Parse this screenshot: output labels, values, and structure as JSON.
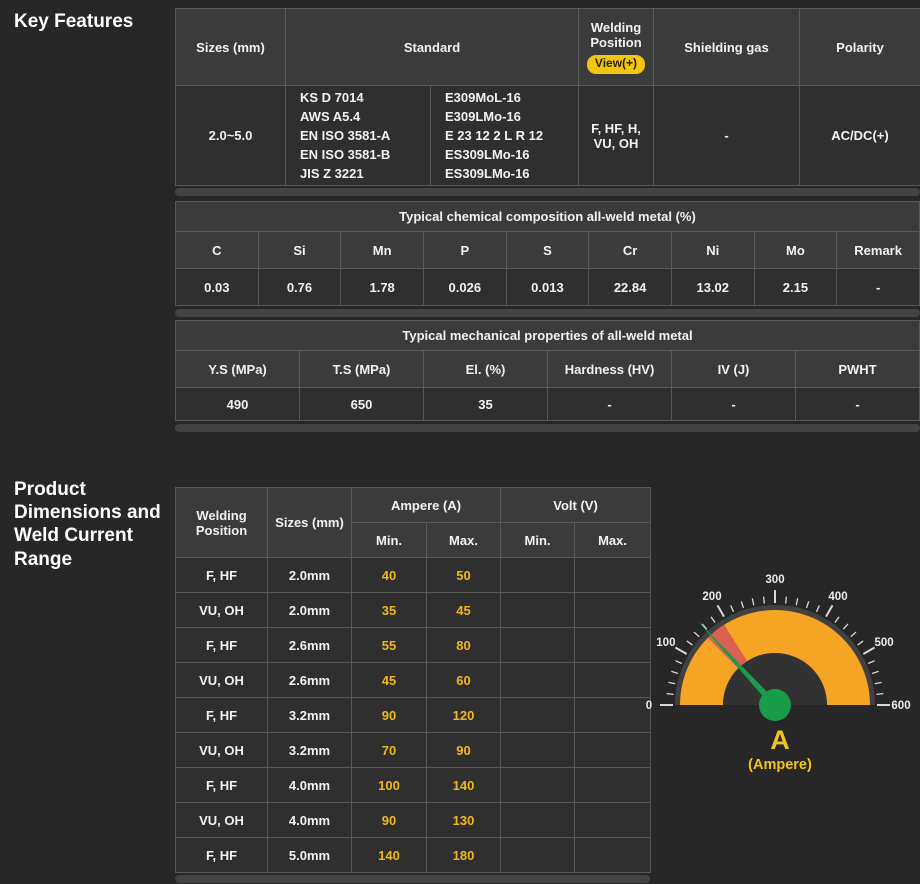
{
  "headings": {
    "key_features": "Key Features",
    "product_dimensions": "Product Dimensions and Weld Current Range"
  },
  "spec_table": {
    "headers": {
      "sizes": "Sizes (mm)",
      "standard": "Standard",
      "welding_position": "Welding Position",
      "view_badge": "View(+)",
      "shielding_gas": "Shielding gas",
      "polarity": "Polarity"
    },
    "row": {
      "sizes": "2.0~5.0",
      "standards_col1": [
        "KS D 7014",
        "AWS A5.4",
        "EN ISO 3581-A",
        "EN ISO 3581-B",
        "JIS Z 3221"
      ],
      "standards_col2": [
        "E309MoL-16",
        "E309LMo-16",
        "E 23 12 2 L R 12",
        "ES309LMo-16",
        "ES309LMo-16"
      ],
      "welding_position": "F, HF, H, VU, OH",
      "shielding_gas": "-",
      "polarity": "AC/DC(+)"
    }
  },
  "chemical_table": {
    "title": "Typical chemical composition all-weld metal (%)",
    "columns": [
      "C",
      "Si",
      "Mn",
      "P",
      "S",
      "Cr",
      "Ni",
      "Mo",
      "Remark"
    ],
    "values": [
      "0.03",
      "0.76",
      "1.78",
      "0.026",
      "0.013",
      "22.84",
      "13.02",
      "2.15",
      "-"
    ]
  },
  "mechanical_table": {
    "title": "Typical mechanical properties of all-weld metal",
    "columns": [
      "Y.S (MPa)",
      "T.S (MPa)",
      "El. (%)",
      "Hardness (HV)",
      "IV (J)",
      "PWHT"
    ],
    "values": [
      "490",
      "650",
      "35",
      "-",
      "-",
      "-"
    ]
  },
  "current_table": {
    "headers": {
      "welding_position": "Welding Position",
      "sizes": "Sizes (mm)",
      "ampere": "Ampere (A)",
      "volt": "Volt (V)"
    },
    "subheaders": [
      "Min.",
      "Max.",
      "Min.",
      "Max."
    ],
    "rows": [
      {
        "position": "F, HF",
        "size": "2.0mm",
        "amp_min": "40",
        "amp_max": "50",
        "volt_min": "",
        "volt_max": ""
      },
      {
        "position": "VU, OH",
        "size": "2.0mm",
        "amp_min": "35",
        "amp_max": "45",
        "volt_min": "",
        "volt_max": ""
      },
      {
        "position": "F, HF",
        "size": "2.6mm",
        "amp_min": "55",
        "amp_max": "80",
        "volt_min": "",
        "volt_max": ""
      },
      {
        "position": "VU, OH",
        "size": "2.6mm",
        "amp_min": "45",
        "amp_max": "60",
        "volt_min": "",
        "volt_max": ""
      },
      {
        "position": "F, HF",
        "size": "3.2mm",
        "amp_min": "90",
        "amp_max": "120",
        "volt_min": "",
        "volt_max": ""
      },
      {
        "position": "VU, OH",
        "size": "3.2mm",
        "amp_min": "70",
        "amp_max": "90",
        "volt_min": "",
        "volt_max": ""
      },
      {
        "position": "F, HF",
        "size": "4.0mm",
        "amp_min": "100",
        "amp_max": "140",
        "volt_min": "",
        "volt_max": ""
      },
      {
        "position": "VU, OH",
        "size": "4.0mm",
        "amp_min": "90",
        "amp_max": "130",
        "volt_min": "",
        "volt_max": ""
      },
      {
        "position": "F, HF",
        "size": "5.0mm",
        "amp_min": "140",
        "amp_max": "180",
        "volt_min": "",
        "volt_max": ""
      }
    ]
  },
  "gauge": {
    "min": 0,
    "max": 600,
    "tick_step": 20,
    "label_step": 100,
    "labels": [
      "0",
      "100",
      "200",
      "300",
      "400",
      "500",
      "600"
    ],
    "needle_value": 158,
    "red_zone_start": 150,
    "red_zone_end": 192,
    "unit": "A",
    "unit_caption": "(Ampere)",
    "band_color": "#f5a423",
    "ring_color": "#414141",
    "inner_color": "#323232",
    "red_zone_color": "#dc6052",
    "needle_color": "#189c49",
    "tick_color": "#d9d9d9",
    "label_color": "#ececec"
  },
  "colors": {
    "accent_yellow": "#f2b71f",
    "badge_yellow": "#f2c511",
    "header_cell": "#3b3b3b",
    "body_cell": "#2f2f2f",
    "background": "#272727"
  }
}
